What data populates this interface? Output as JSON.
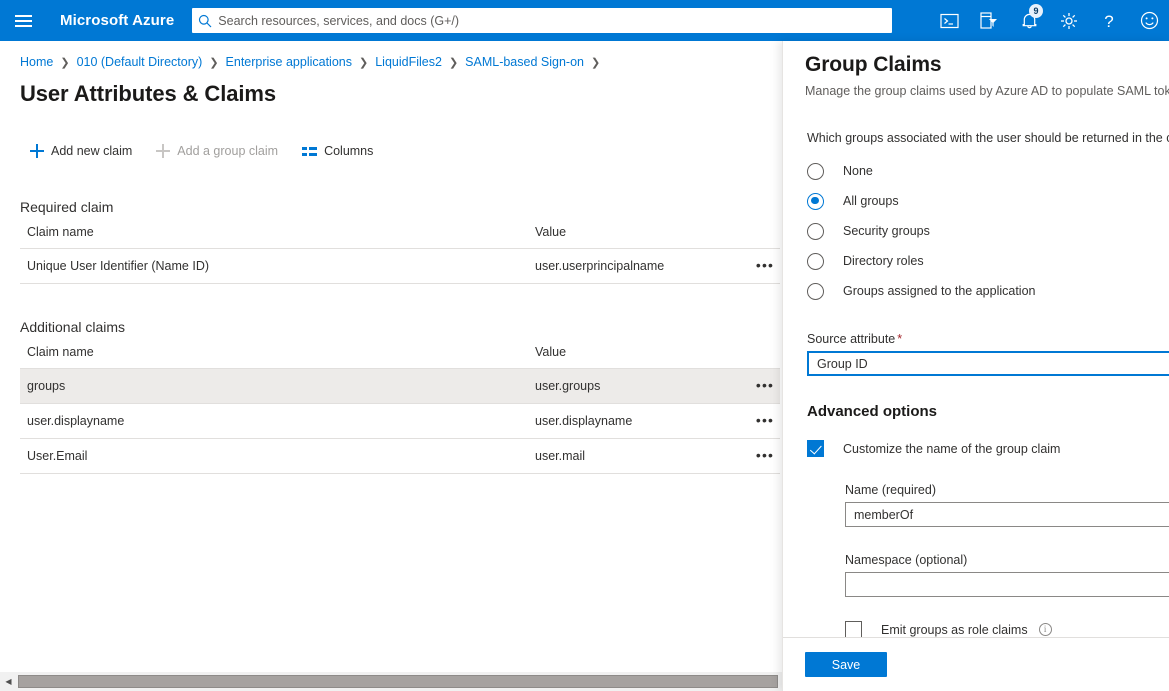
{
  "topbar": {
    "menu_icon": "hamburger-icon",
    "brand": "Microsoft Azure",
    "search": {
      "icon": "search-icon",
      "placeholder": "Search resources, services, and docs (G+/)",
      "value": ""
    },
    "icons": [
      {
        "name": "cloud-shell-icon",
        "glyph": ">_"
      },
      {
        "name": "directory-filter-icon",
        "glyph": "filter"
      },
      {
        "name": "notifications-icon",
        "glyph": "bell",
        "badge": "9"
      },
      {
        "name": "settings-icon",
        "glyph": "gear"
      },
      {
        "name": "help-icon",
        "glyph": "?"
      },
      {
        "name": "feedback-icon",
        "glyph": "smiley"
      }
    ]
  },
  "breadcrumb": [
    "Home",
    "010 (Default Directory)",
    "Enterprise applications",
    "LiquidFiles2",
    "SAML-based Sign-on"
  ],
  "page": {
    "title": "User Attributes & Claims"
  },
  "toolbar": {
    "add_new_claim": "Add new claim",
    "add_group_claim": "Add a group claim",
    "columns": "Columns"
  },
  "required_claims": {
    "section_title": "Required claim",
    "headers": {
      "name": "Claim name",
      "value": "Value"
    },
    "rows": [
      {
        "name": "Unique User Identifier (Name ID)",
        "value": "user.userprincipalname",
        "selected": false
      }
    ]
  },
  "additional_claims": {
    "section_title": "Additional claims",
    "headers": {
      "name": "Claim name",
      "value": "Value"
    },
    "rows": [
      {
        "name": "groups",
        "value": "user.groups",
        "selected": true
      },
      {
        "name": "user.displayname",
        "value": "user.displayname",
        "selected": false
      },
      {
        "name": "User.Email",
        "value": "user.mail",
        "selected": false
      }
    ]
  },
  "menu_glyph": "•••",
  "panel": {
    "title": "Group Claims",
    "subtitle": "Manage the group claims used by Azure AD to populate SAML toke",
    "question": "Which groups associated with the user should be returned in the c",
    "radio_options": [
      {
        "label": "None",
        "checked": false
      },
      {
        "label": "All groups",
        "checked": true
      },
      {
        "label": "Security groups",
        "checked": false
      },
      {
        "label": "Directory roles",
        "checked": false
      },
      {
        "label": "Groups assigned to the application",
        "checked": false
      }
    ],
    "source_attribute": {
      "label": "Source attribute",
      "required_marker": "*",
      "value": "Group ID"
    },
    "advanced_options": {
      "title": "Advanced options",
      "customize_name": {
        "label": "Customize the name of the group claim",
        "checked": true
      },
      "name_field": {
        "label": "Name (required)",
        "value": "memberOf"
      },
      "namespace_field": {
        "label": "Namespace (optional)",
        "value": ""
      },
      "emit_role_claims": {
        "label": "Emit groups as role claims",
        "checked": false,
        "info_icon": "info-icon"
      }
    },
    "save_label": "Save"
  },
  "colors": {
    "azure_blue": "#0078d4",
    "selected_row": "#edebe9",
    "required_red": "#a4262c"
  }
}
